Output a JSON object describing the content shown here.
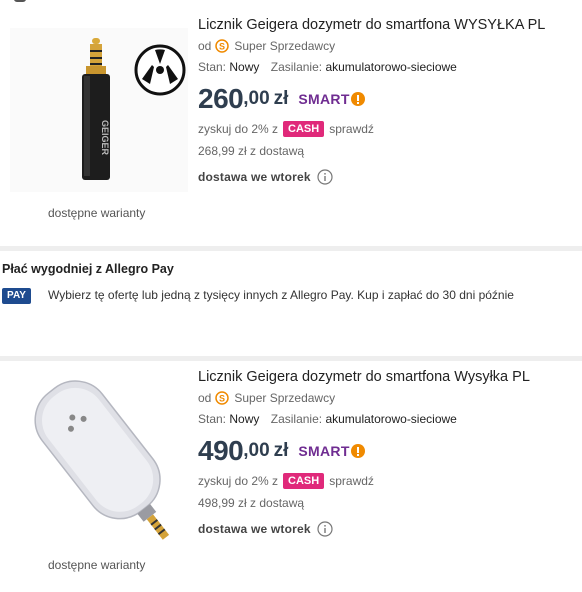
{
  "offers": [
    {
      "title": "Licznik Geigera dozymetr do smartfona WYSYŁKA PL",
      "seller_prefix": "od",
      "seller": "Super Sprzedawcy",
      "condition_label": "Stan:",
      "condition_value": "Nowy",
      "power_label": "Zasilanie:",
      "power_value": "akumulatorowo-sieciowe",
      "price_main": "260",
      "price_frac": ",00",
      "currency": "zł",
      "smart_label": "SMART",
      "cash_prefix": "zyskuj do 2% z",
      "cash_badge": "CASH",
      "cash_suffix": "sprawdź",
      "delivery_price": "268,99 zł z dostawą",
      "delivery_when": "dostawa we wtorek",
      "variants": "dostępne warianty",
      "image_text": "GEIGER"
    },
    {
      "title": "Licznik Geigera dozymetr do smartfona Wysyłka PL",
      "seller_prefix": "od",
      "seller": "Super Sprzedawcy",
      "condition_label": "Stan:",
      "condition_value": "Nowy",
      "power_label": "Zasilanie:",
      "power_value": "akumulatorowo-sieciowe",
      "price_main": "490",
      "price_frac": ",00",
      "currency": "zł",
      "smart_label": "SMART",
      "cash_prefix": "zyskuj do 2% z",
      "cash_badge": "CASH",
      "cash_suffix": "sprawdź",
      "delivery_price": "498,99 zł z dostawą",
      "delivery_when": "dostawa we wtorek",
      "variants": "dostępne warianty"
    }
  ],
  "promo": {
    "title": "Płać wygodniej z Allegro Pay",
    "badge": "PAY",
    "text": "Wybierz tę ofertę lub jedną z tysięcy innych z Allegro Pay. Kup i zapłać do 30 dni późnie"
  },
  "colors": {
    "price": "#2f3e4f",
    "smart": "#6f2c91",
    "smart_bang": "#f08a00",
    "cash": "#e0297a",
    "pay": "#1e4b8f",
    "super_seller": "#f08a00"
  }
}
